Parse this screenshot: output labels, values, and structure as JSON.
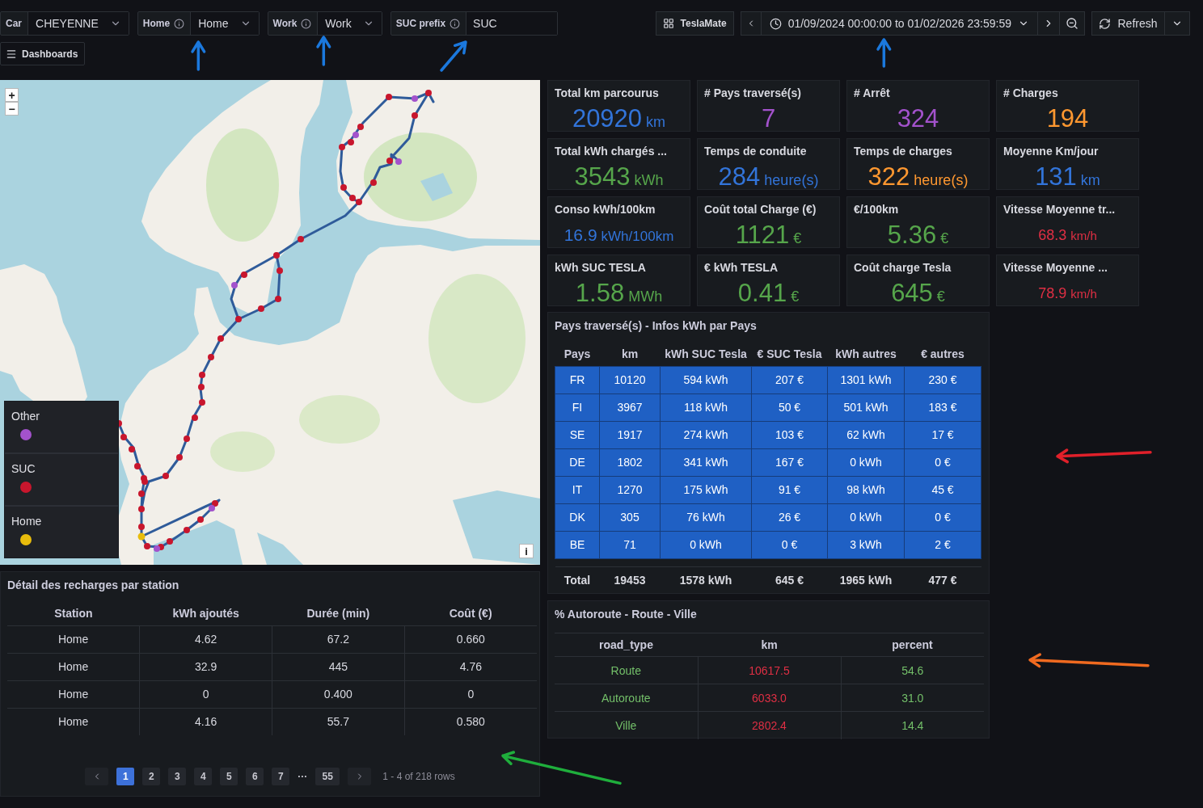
{
  "variables": [
    {
      "label": "Car",
      "info": false,
      "kind": "select",
      "value": "CHEYENNE"
    },
    {
      "label": "Home",
      "info": true,
      "kind": "select",
      "value": "Home"
    },
    {
      "label": "Work",
      "info": true,
      "kind": "select",
      "value": "Work"
    },
    {
      "label": "SUC prefix",
      "info": true,
      "kind": "text",
      "value": "SUC"
    }
  ],
  "dashboards_button": "Dashboards",
  "toolbar": {
    "dashboard_link": "TeslaMate",
    "time_range": "01/09/2024 00:00:00 to 01/02/2026 23:59:59",
    "refresh": "Refresh"
  },
  "map": {
    "zoom_in": "+",
    "zoom_out": "−",
    "info": "i",
    "legend": [
      {
        "label": "Other",
        "color": "#a352cc"
      },
      {
        "label": "SUC",
        "color": "#c8162d"
      },
      {
        "label": "Home",
        "color": "#e8bc0c"
      }
    ]
  },
  "stats": [
    {
      "title": "Total km parcourus",
      "value": "20920",
      "unit": "km",
      "color": "#3274d9"
    },
    {
      "title": "# Pays traversé(s)",
      "value": "7",
      "color": "#a352cc"
    },
    {
      "title": "# Arrêt",
      "value": "324",
      "color": "#a352cc"
    },
    {
      "title": "# Charges",
      "value": "194",
      "color": "#ff9830"
    },
    {
      "title": "Total kWh chargés ...",
      "value": "3543",
      "unit": "kWh",
      "color": "#56a64b"
    },
    {
      "title": "Temps de conduite",
      "value": "284",
      "unit": "heure(s)",
      "color": "#3274d9"
    },
    {
      "title": "Temps de charges",
      "value": "322",
      "unit": "heure(s)",
      "color": "#ff9830"
    },
    {
      "title": "Moyenne Km/jour",
      "value": "131",
      "unit": "km",
      "color": "#3274d9"
    },
    {
      "title": "Conso kWh/100km",
      "value": "16.9",
      "unit": "kWh/100km",
      "color": "#3274d9"
    },
    {
      "title": "Coût total Charge (€)",
      "value": "1121",
      "unit": "€",
      "color": "#56a64b"
    },
    {
      "title": "€/100km",
      "value": "5.36",
      "unit": "€",
      "color": "#56a64b"
    },
    {
      "title": "Vitesse Moyenne tr...",
      "value": "68.3",
      "unit": "km/h",
      "color": "#e02f44"
    },
    {
      "title": "kWh SUC TESLA",
      "value": "1.58",
      "unit": "MWh",
      "color": "#56a64b"
    },
    {
      "title": "€ kWh TESLA",
      "value": "0.41",
      "unit": "€",
      "color": "#56a64b"
    },
    {
      "title": "Coût charge Tesla",
      "value": "645",
      "unit": "€",
      "color": "#56a64b"
    },
    {
      "title": "Vitesse Moyenne ...",
      "value": "78.9",
      "unit": "km/h",
      "color": "#e02f44"
    }
  ],
  "countries_panel": {
    "title": "Pays traversé(s) - Infos kWh par Pays",
    "columns": [
      "Pays",
      "km",
      "kWh SUC Tesla",
      "€ SUC Tesla",
      "kWh autres",
      "€ autres"
    ],
    "rows": [
      [
        "FR",
        "10120",
        "594 kWh",
        "207 €",
        "1301 kWh",
        "230 €"
      ],
      [
        "FI",
        "3967",
        "118 kWh",
        "50 €",
        "501 kWh",
        "183 €"
      ],
      [
        "SE",
        "1917",
        "274 kWh",
        "103 €",
        "62 kWh",
        "17 €"
      ],
      [
        "DE",
        "1802",
        "341 kWh",
        "167 €",
        "0 kWh",
        "0 €"
      ],
      [
        "IT",
        "1270",
        "175 kWh",
        "91 €",
        "98 kWh",
        "45 €"
      ],
      [
        "DK",
        "305",
        "76 kWh",
        "26 €",
        "0 kWh",
        "0 €"
      ],
      [
        "BE",
        "71",
        "0 kWh",
        "0 €",
        "3 kWh",
        "2 €"
      ]
    ],
    "total": [
      "Total",
      "19453",
      "1578 kWh",
      "645 €",
      "1965 kWh",
      "477 €"
    ]
  },
  "road_panel": {
    "title": "% Autoroute - Route - Ville",
    "columns": [
      {
        "label": "road_type",
        "color": "#73bf69"
      },
      {
        "label": "km",
        "color": "#e02f44"
      },
      {
        "label": "percent",
        "color": "#73bf69"
      }
    ],
    "rows": [
      [
        "Route",
        "10617.5",
        "54.6"
      ],
      [
        "Autoroute",
        "6033.0",
        "31.0"
      ],
      [
        "Ville",
        "2802.4",
        "14.4"
      ]
    ]
  },
  "charges_panel": {
    "title": "Détail des recharges par station",
    "columns": [
      "Station",
      "kWh ajoutés",
      "Durée (min)",
      "Coût (€)"
    ],
    "rows": [
      [
        "Home",
        "4.62",
        "67.2",
        "0.660"
      ],
      [
        "Home",
        "32.9",
        "445",
        "4.76"
      ],
      [
        "Home",
        "0",
        "0.400",
        "0"
      ],
      [
        "Home",
        "4.16",
        "55.7",
        "0.580"
      ]
    ],
    "pagination": {
      "pages": [
        {
          "label": "1",
          "selected": true
        },
        {
          "label": "2",
          "selected": false
        },
        {
          "label": "3",
          "selected": false
        },
        {
          "label": "4",
          "selected": false
        },
        {
          "label": "5",
          "selected": false
        },
        {
          "label": "6",
          "selected": false
        },
        {
          "label": "7",
          "selected": false
        }
      ],
      "gap": "···",
      "last_page": {
        "label": "55",
        "selected": false
      },
      "summary": "1 - 4 of 218 rows"
    }
  }
}
